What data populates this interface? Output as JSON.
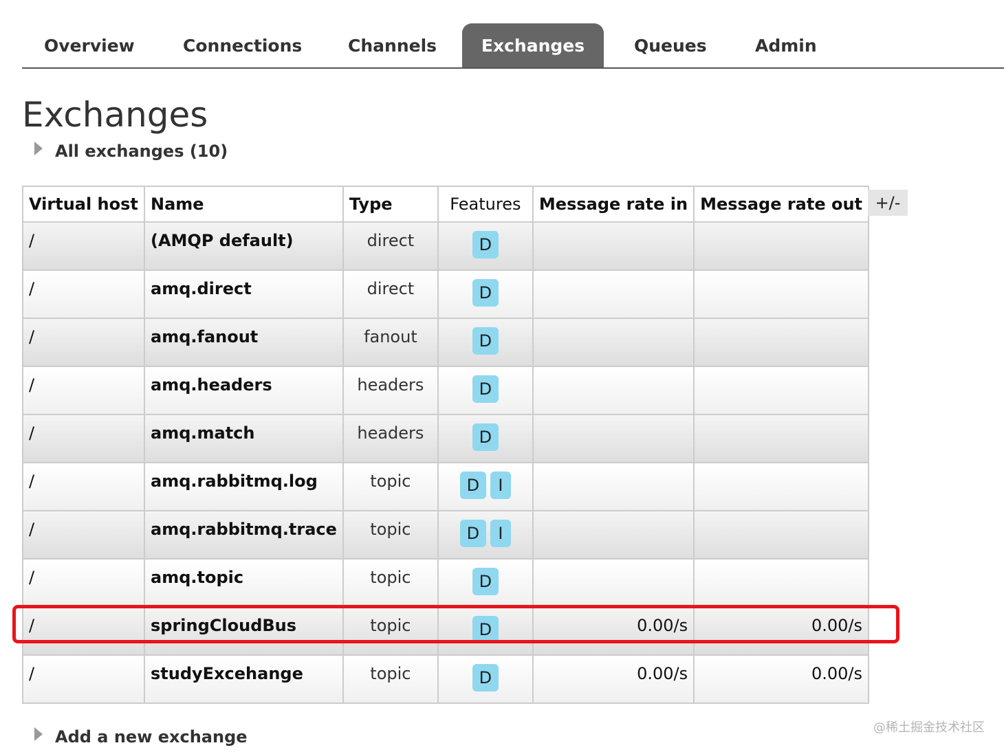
{
  "nav": {
    "items": [
      {
        "label": "Overview",
        "active": false
      },
      {
        "label": "Connections",
        "active": false
      },
      {
        "label": "Channels",
        "active": false
      },
      {
        "label": "Exchanges",
        "active": true
      },
      {
        "label": "Queues",
        "active": false
      },
      {
        "label": "Admin",
        "active": false
      }
    ]
  },
  "page": {
    "title": "Exchanges",
    "all_exchanges_label": "All exchanges (10)",
    "add_exchange_label": "Add a new exchange",
    "columns_toggle_label": "+/-"
  },
  "table": {
    "headers": {
      "vhost": "Virtual host",
      "name": "Name",
      "type": "Type",
      "features": "Features",
      "rate_in": "Message rate in",
      "rate_out": "Message rate out"
    },
    "rows": [
      {
        "vhost": "/",
        "name": "(AMQP default)",
        "type": "direct",
        "features": [
          "D"
        ],
        "rate_in": "",
        "rate_out": ""
      },
      {
        "vhost": "/",
        "name": "amq.direct",
        "type": "direct",
        "features": [
          "D"
        ],
        "rate_in": "",
        "rate_out": ""
      },
      {
        "vhost": "/",
        "name": "amq.fanout",
        "type": "fanout",
        "features": [
          "D"
        ],
        "rate_in": "",
        "rate_out": ""
      },
      {
        "vhost": "/",
        "name": "amq.headers",
        "type": "headers",
        "features": [
          "D"
        ],
        "rate_in": "",
        "rate_out": ""
      },
      {
        "vhost": "/",
        "name": "amq.match",
        "type": "headers",
        "features": [
          "D"
        ],
        "rate_in": "",
        "rate_out": ""
      },
      {
        "vhost": "/",
        "name": "amq.rabbitmq.log",
        "type": "topic",
        "features": [
          "D",
          "I"
        ],
        "rate_in": "",
        "rate_out": ""
      },
      {
        "vhost": "/",
        "name": "amq.rabbitmq.trace",
        "type": "topic",
        "features": [
          "D",
          "I"
        ],
        "rate_in": "",
        "rate_out": ""
      },
      {
        "vhost": "/",
        "name": "amq.topic",
        "type": "topic",
        "features": [
          "D"
        ],
        "rate_in": "",
        "rate_out": ""
      },
      {
        "vhost": "/",
        "name": "springCloudBus",
        "type": "topic",
        "features": [
          "D"
        ],
        "rate_in": "0.00/s",
        "rate_out": "0.00/s",
        "highlighted": true
      },
      {
        "vhost": "/",
        "name": "studyExcehange",
        "type": "topic",
        "features": [
          "D"
        ],
        "rate_in": "0.00/s",
        "rate_out": "0.00/s"
      }
    ]
  },
  "colors": {
    "nav_active_bg": "#666666",
    "feature_badge": "#8fd8ef",
    "highlight_border": "#e8141c"
  },
  "watermark": "@稀土掘金技术社区"
}
